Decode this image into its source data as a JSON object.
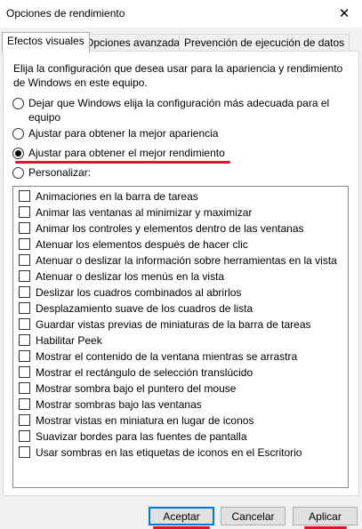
{
  "window": {
    "title": "Opciones de rendimiento",
    "close_glyph": "✕"
  },
  "tabs": [
    {
      "label": "Efectos visuales",
      "active": true
    },
    {
      "label": "Opciones avanzadas",
      "active": false
    },
    {
      "label": "Prevención de ejecución de datos",
      "active": false
    }
  ],
  "visual_effects": {
    "description": "Elija la configuración que desea usar para la apariencia y rendimiento de Windows en este equipo.",
    "options": [
      {
        "label": "Dejar que Windows elija la configuración más adecuada para el equipo",
        "checked": false
      },
      {
        "label": "Ajustar para obtener la mejor apariencia",
        "checked": false
      },
      {
        "label": "Ajustar para obtener el mejor rendimiento",
        "checked": true
      },
      {
        "label": "Personalizar:",
        "checked": false
      }
    ],
    "effects": [
      {
        "label": "Animaciones en la barra de tareas",
        "checked": false
      },
      {
        "label": "Animar las ventanas al minimizar y maximizar",
        "checked": false
      },
      {
        "label": "Animar los controles y elementos dentro de las ventanas",
        "checked": false
      },
      {
        "label": "Atenuar los elementos después de hacer clic",
        "checked": false
      },
      {
        "label": "Atenuar o deslizar la información sobre herramientas en la vista",
        "checked": false
      },
      {
        "label": "Atenuar o deslizar los menús en la vista",
        "checked": false
      },
      {
        "label": "Deslizar los cuadros combinados al abrirlos",
        "checked": false
      },
      {
        "label": "Desplazamiento suave de los cuadros de lista",
        "checked": false
      },
      {
        "label": "Guardar vistas previas de miniaturas de la barra de tareas",
        "checked": false
      },
      {
        "label": "Habilitar Peek",
        "checked": false
      },
      {
        "label": "Mostrar el contenido de la ventana mientras se arrastra",
        "checked": false
      },
      {
        "label": "Mostrar el rectángulo de selección translúcido",
        "checked": false
      },
      {
        "label": "Mostrar sombra bajo el puntero del mouse",
        "checked": false
      },
      {
        "label": "Mostrar sombras bajo las ventanas",
        "checked": false
      },
      {
        "label": "Mostrar vistas en miniatura en lugar de iconos",
        "checked": false
      },
      {
        "label": "Suavizar bordes para las fuentes de pantalla",
        "checked": false
      },
      {
        "label": "Usar sombras en las etiquetas de iconos en el Escritorio",
        "checked": false
      }
    ]
  },
  "buttons": {
    "accept": "Aceptar",
    "cancel": "Cancelar",
    "apply": "Aplicar"
  },
  "colors": {
    "annotation_red": "#e8102a",
    "default_button_border": "#0078d7"
  }
}
